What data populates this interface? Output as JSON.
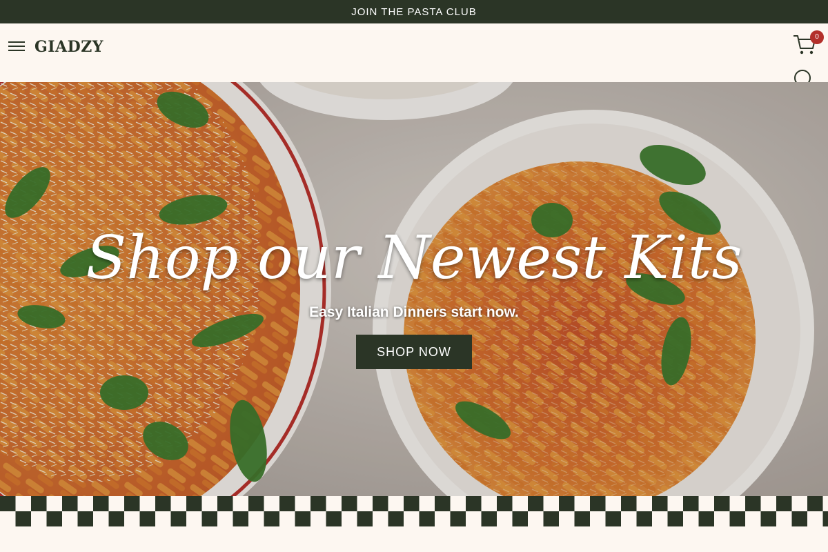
{
  "announcement": {
    "text": "JOIN THE PASTA CLUB"
  },
  "header": {
    "logo": "GIADZY",
    "cart_count": "0",
    "icons": {
      "menu": "hamburger-menu-icon",
      "cart": "cart-icon",
      "search": "search-icon"
    }
  },
  "hero": {
    "title": "Shop our Newest Kits",
    "subtitle": "Easy Italian Dinners start now.",
    "cta_label": "SHOP NOW"
  },
  "colors": {
    "brand_dark": "#2b3526",
    "background": "#fdf7f1",
    "badge": "#b3302a",
    "checker_dark": "#2b3526",
    "checker_light": "#fdf7f1"
  }
}
